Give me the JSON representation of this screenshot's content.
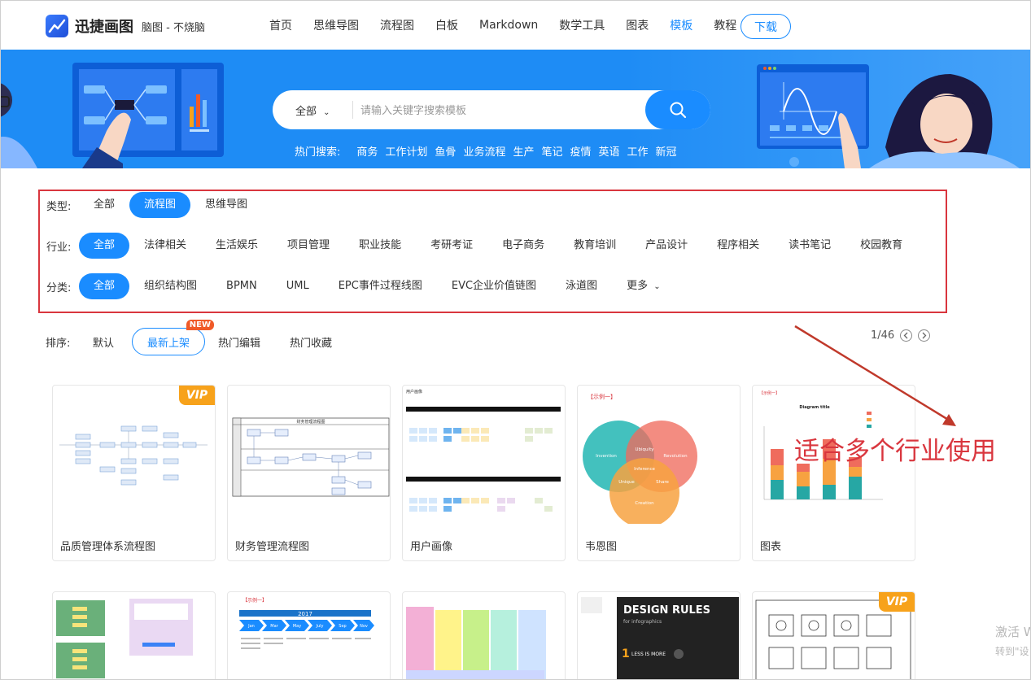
{
  "header": {
    "brand": "迅捷画图",
    "tagline": "脑图 - 不烧脑",
    "nav": [
      "首页",
      "思维导图",
      "流程图",
      "白板",
      "Markdown",
      "数学工具",
      "图表",
      "模板",
      "教程"
    ],
    "nav_active": "模板",
    "download": "下载"
  },
  "banner": {
    "scope": "全部",
    "placeholder": "请输入关键字搜索模板",
    "hot_label": "热门搜索:",
    "hot": [
      "商务",
      "工作计划",
      "鱼骨",
      "业务流程",
      "生产",
      "笔记",
      "疫情",
      "英语",
      "工作",
      "新冠"
    ]
  },
  "filters": {
    "type": {
      "label": "类型:",
      "items": [
        "全部",
        "流程图",
        "思维导图"
      ],
      "selected": "流程图"
    },
    "industry": {
      "label": "行业:",
      "items": [
        "全部",
        "法律相关",
        "生活娱乐",
        "项目管理",
        "职业技能",
        "考研考证",
        "电子商务",
        "教育培训",
        "产品设计",
        "程序相关",
        "读书笔记",
        "校园教育"
      ],
      "selected": "全部"
    },
    "category": {
      "label": "分类:",
      "items": [
        "全部",
        "组织结构图",
        "BPMN",
        "UML",
        "EPC事件过程线图",
        "EVC企业价值链图",
        "泳道图",
        "更多"
      ],
      "selected": "全部"
    }
  },
  "sort": {
    "label": "排序:",
    "items": [
      "默认",
      "最新上架",
      "热门编辑",
      "热门收藏"
    ],
    "selected": "最新上架",
    "badge": "NEW",
    "pager": "1/46"
  },
  "cards": [
    {
      "title": "品质管理体系流程图",
      "vip": true
    },
    {
      "title": "财务管理流程图",
      "vip": false
    },
    {
      "title": "用户画像",
      "vip": false
    },
    {
      "title": "韦恩图",
      "vip": false
    },
    {
      "title": "图表",
      "vip": false
    }
  ],
  "card_badges": {
    "vip": "VIP"
  },
  "card_thumbs": {
    "flow2_title": "财务管理流程图",
    "persona_title": "用户画像",
    "example": "【示例一】",
    "venn": [
      "Invention",
      "Revolution",
      "Creation",
      "Unique",
      "Share",
      "Ubiquity",
      "Inference"
    ],
    "chart_title": "Diagram title",
    "year": "2017",
    "months": [
      "Jan",
      "Mar",
      "May",
      "July",
      "Sep",
      "Nov"
    ],
    "design_title": "DESIGN RULES",
    "design_sub": "for infographics",
    "design_point": "LESS IS MORE"
  },
  "annotation": "适合多个行业使用",
  "watermark": [
    "激活 W",
    "转到\"设"
  ],
  "colors": {
    "brand": "#1a8cff",
    "banner": "#1e8cf5",
    "highlight": "#d9363e",
    "vip": "#f7a21b",
    "new": "#f05a28"
  }
}
